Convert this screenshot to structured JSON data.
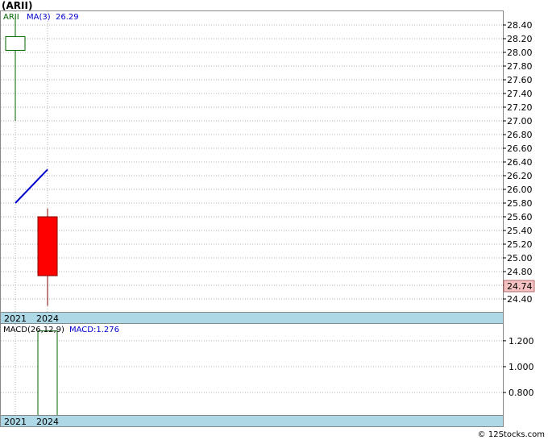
{
  "ticker": "(ARII)",
  "watermark": "© 12Stocks.com",
  "colors": {
    "up": "#006400",
    "down": "#ff0000",
    "ma_line": "#0000cc",
    "macd_label": "#0000cc",
    "axis_strip": "#add8e6",
    "last_price_box": "#f4c2c2",
    "grid": "#b0b0b0"
  },
  "chart_data": [
    {
      "type": "candlestick",
      "panel": "price",
      "legend": {
        "symbol": "ARII",
        "ma_label": "MA(3)",
        "ma_value": "26.29"
      },
      "categories": [
        "2021",
        "2024"
      ],
      "ohlc": [
        {
          "x": "2021",
          "open": 28.03,
          "high": 28.52,
          "low": 27.0,
          "close": 28.23
        },
        {
          "x": "2024",
          "open": 25.6,
          "high": 25.72,
          "low": 24.3,
          "close": 24.74
        }
      ],
      "ma": [
        {
          "x": "2021",
          "value": 25.8
        },
        {
          "x": "2024",
          "value": 26.29
        }
      ],
      "last_price": "24.74",
      "ylim": [
        24.2,
        28.6
      ],
      "yticks": [
        "28.40",
        "28.20",
        "28.00",
        "27.80",
        "27.60",
        "27.40",
        "27.20",
        "27.00",
        "26.80",
        "26.60",
        "26.40",
        "26.20",
        "26.00",
        "25.80",
        "25.60",
        "25.40",
        "25.20",
        "25.00",
        "24.80",
        "24.60",
        "24.40"
      ],
      "grid": true
    },
    {
      "type": "bar",
      "panel": "macd",
      "label": "MACD(26,12,9)",
      "value_label": "MACD:1.276",
      "categories": [
        "2021",
        "2024"
      ],
      "values": [
        null,
        1.276
      ],
      "ylim": [
        0.62,
        1.33
      ],
      "yticks": [
        "1.200",
        "1.000",
        "0.800"
      ],
      "grid": true
    }
  ]
}
